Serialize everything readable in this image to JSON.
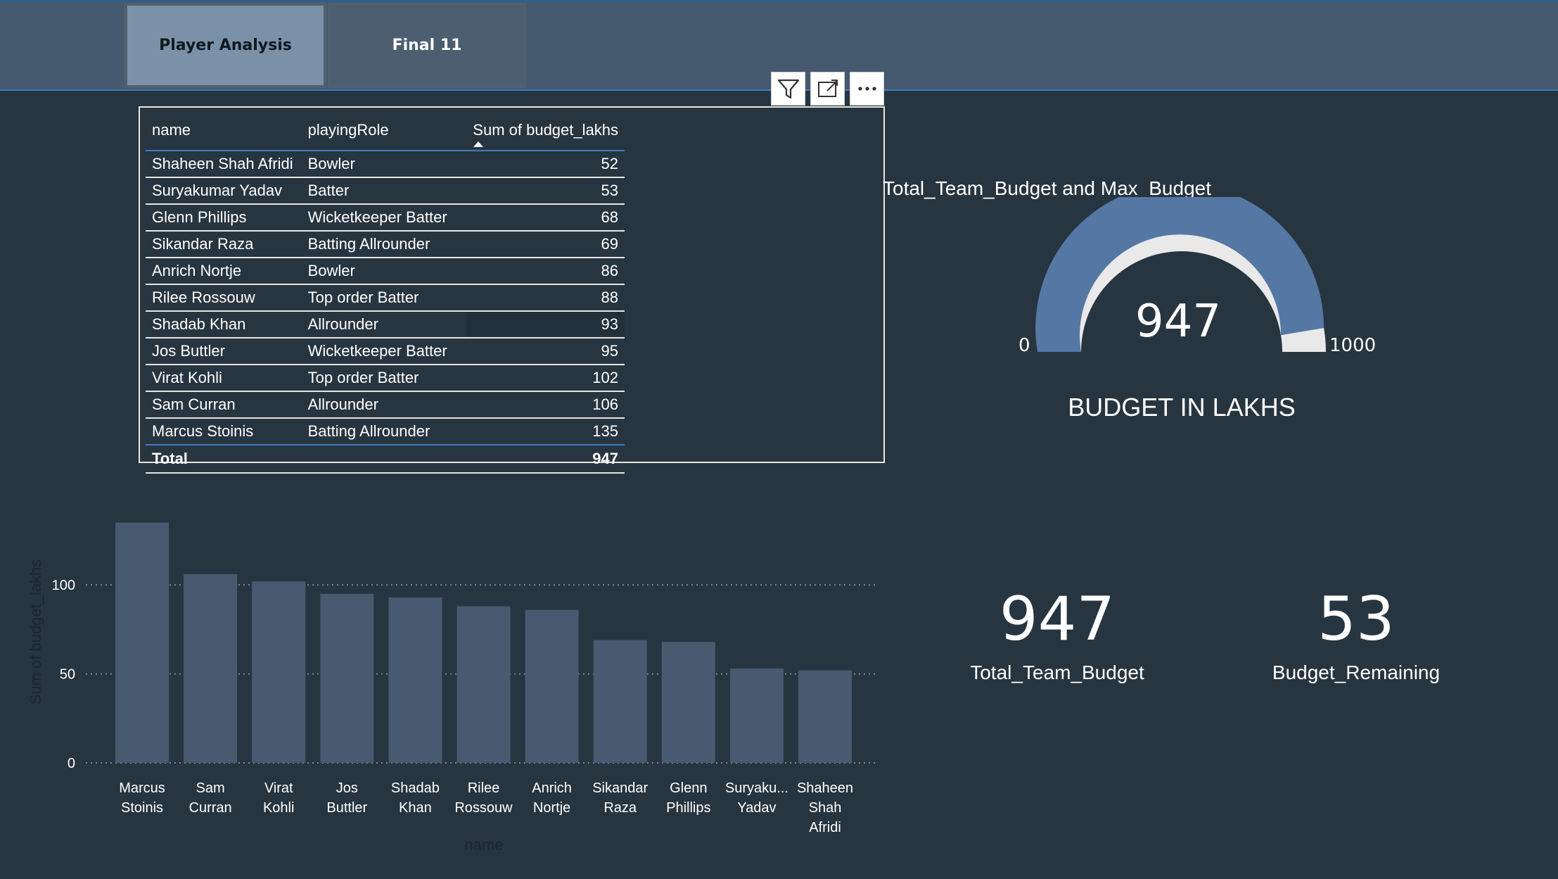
{
  "tabs": [
    {
      "label": "Player Analysis",
      "active": true
    },
    {
      "label": "Final 11",
      "active": false
    }
  ],
  "visual_header_icons": [
    "filter-icon",
    "focus-mode-icon",
    "more-options-icon"
  ],
  "table": {
    "columns": [
      "name",
      "playingRole",
      "Sum of budget_lakhs"
    ],
    "rows": [
      {
        "name": "Shaheen Shah Afridi",
        "role": "Bowler",
        "budget": "52"
      },
      {
        "name": "Suryakumar Yadav",
        "role": "Batter",
        "budget": "53"
      },
      {
        "name": "Glenn Phillips",
        "role": "Wicketkeeper Batter",
        "budget": "68"
      },
      {
        "name": "Sikandar Raza",
        "role": "Batting Allrounder",
        "budget": "69"
      },
      {
        "name": "Anrich Nortje",
        "role": "Bowler",
        "budget": "86"
      },
      {
        "name": "Rilee Rossouw",
        "role": "Top order Batter",
        "budget": "88"
      },
      {
        "name": "Shadab Khan",
        "role": "Allrounder",
        "budget": "93"
      },
      {
        "name": "Jos Buttler",
        "role": "Wicketkeeper Batter",
        "budget": "95"
      },
      {
        "name": "Virat Kohli",
        "role": "Top order Batter",
        "budget": "102"
      },
      {
        "name": "Sam Curran",
        "role": "Allrounder",
        "budget": "106"
      },
      {
        "name": "Marcus Stoinis",
        "role": "Batting Allrounder",
        "budget": "135"
      }
    ],
    "total_label": "Total",
    "total_value": "947"
  },
  "gauge": {
    "title": "Total_Team_Budget and Max_Budget",
    "value": "947",
    "min": "0",
    "max": "1000",
    "caption": "BUDGET IN LAKHS",
    "value_num": 947,
    "max_num": 1000,
    "fill_color": "#5577a3",
    "track_color": "#e9e9e9"
  },
  "cards": [
    {
      "value": "947",
      "label": "Total_Team_Budget"
    },
    {
      "value": "53",
      "label": "Budget_Remaining"
    }
  ],
  "chart_data": {
    "type": "bar",
    "xlabel": "name",
    "ylabel": "Sum of budget_lakhs",
    "categories": [
      [
        "Marcus",
        "Stoinis"
      ],
      [
        "Sam",
        "Curran"
      ],
      [
        "Virat",
        "Kohli"
      ],
      [
        "Jos",
        "Buttler"
      ],
      [
        "Shadab",
        "Khan"
      ],
      [
        "Rilee",
        "Rossouw"
      ],
      [
        "Anrich",
        "Nortje"
      ],
      [
        "Sikandar",
        "Raza"
      ],
      [
        "Glenn",
        "Phillips"
      ],
      [
        "Suryaku...",
        "Yadav"
      ],
      [
        "Shaheen",
        "Shah",
        "Afridi"
      ]
    ],
    "values": [
      135,
      106,
      102,
      95,
      93,
      88,
      86,
      69,
      68,
      53,
      52
    ],
    "yticks": [
      "0",
      "50",
      "100"
    ],
    "ytick_values": [
      0,
      50,
      100
    ],
    "ylim": [
      0,
      140
    ],
    "bar_color": "#475a70",
    "gridlines": "dotted"
  }
}
